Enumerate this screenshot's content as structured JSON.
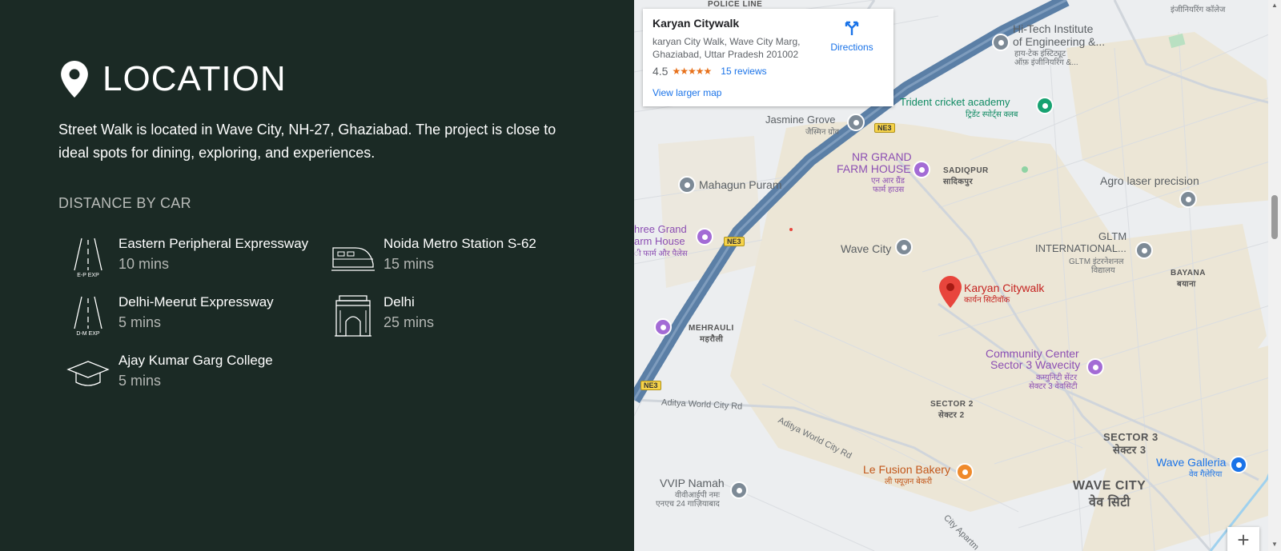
{
  "location": {
    "title": "LOCATION",
    "description": "Street Walk is located in Wave City, NH-27, Ghaziabad. The project is close to ideal spots for dining, exploring, and experiences.",
    "distance_title": "DISTANCE BY CAR",
    "items": [
      {
        "name": "Eastern Peripheral Expressway",
        "time": "10 mins",
        "icon": "road-icon",
        "icon_caption": "E-P EXP"
      },
      {
        "name": "Noida Metro Station S-62",
        "time": "15 mins",
        "icon": "metro-train-icon"
      },
      {
        "name": "Delhi-Meerut Expressway",
        "time": "5 mins",
        "icon": "road-icon",
        "icon_caption": "D-M EXP"
      },
      {
        "name": "Delhi",
        "time": "25 mins",
        "icon": "india-gate-icon"
      },
      {
        "name": "Ajay Kumar Garg College",
        "time": "5 mins",
        "icon": "graduation-cap-icon"
      }
    ]
  },
  "map": {
    "card": {
      "title": "Karyan Citywalk",
      "address": "karyan City Walk, Wave City Marg, Ghaziabad, Uttar Pradesh 201002",
      "rating": "4.5",
      "stars": "★★★★★",
      "reviews": "15 reviews",
      "view_larger": "View larger map",
      "directions": "Directions"
    },
    "labels": {
      "police_line": "POLICE LINE",
      "hitech": "Hi-Tech Institute",
      "hitech2": "of Engineering &...",
      "hitech_hi": "हाय-टेक इंस्टिट्यूट",
      "hitech_hi2": "ऑफ़ इंजीनियरिंग &...",
      "eng_college_hi": "इंजीनियरिंग कॉलेज",
      "trident": "Trident cricket academy",
      "trident_hi": "ट्रिडेंट स्पोर्ट्स क्लब",
      "jasmine": "Jasmine Grove",
      "jasmine_hi": "जैस्मिन ग्रोव",
      "nr_grand": "NR GRAND",
      "farm_house": "FARM HOUSE",
      "nr_hi": "एन आर ग्रैंड",
      "nr_hi2": "फार्म हाउस",
      "sadiqpur": "SADIQPUR",
      "sadiqpur_hi": "सादिकपुर",
      "agro": "Agro laser precision",
      "mahagun": "Mahagun Puram",
      "shree": "hree Grand",
      "shree2": "arm House",
      "shree_hi": "ी फार्म और पैलेस",
      "wave_city": "Wave City",
      "gltm": "GLTM",
      "gltm2": "INTERNATIONAL...",
      "gltm_hi": "GLTM इंटरनेशनल",
      "gltm_hi2": "विद्यालय",
      "bayana": "BAYANA",
      "bayana_hi": "बयाना",
      "karyan": "Karyan Citywalk",
      "karyan_hi": "कार्यन सिटीवॉक",
      "mehrauli": "MEHRAULI",
      "mehrauli_hi": "महरौली",
      "community": "Community Center",
      "community2": "Sector 3 Wavecity",
      "community_hi": "कम्युनिटी सेंटर",
      "community_hi2": "सेक्टर 3 वेवसिटी",
      "aditya": "Aditya World City Rd",
      "aditya2": "Aditya World City Rd",
      "sector2": "SECTOR 2",
      "sector2_hi": "सेक्टर 2",
      "sector3": "SECTOR 3",
      "sector3_hi": "सेक्टर 3",
      "lefusion": "Le Fusion Bakery",
      "lefusion_hi": "ली फ्यूज़न बेकरी",
      "wave_galleria": "Wave Galleria",
      "wave_galleria_hi": "वेव गैलेरिया",
      "wave_city_big": "WAVE CITY",
      "wave_city_big_hi": "वेव सिटी",
      "vvip": "VVIP Namah",
      "vvip_hi": "वीवीआईपी नमः",
      "vvip_hi2": "एनएच 24 गाज़ियाबाद",
      "city_apart": "City Apartm",
      "ne3": "NE3"
    },
    "zoom_in": "+"
  },
  "colors": {
    "panel_bg": "#1b2a25",
    "map_bg": "#eceef0",
    "highway": "#5b7fa6",
    "marker_red": "#e8453c"
  }
}
